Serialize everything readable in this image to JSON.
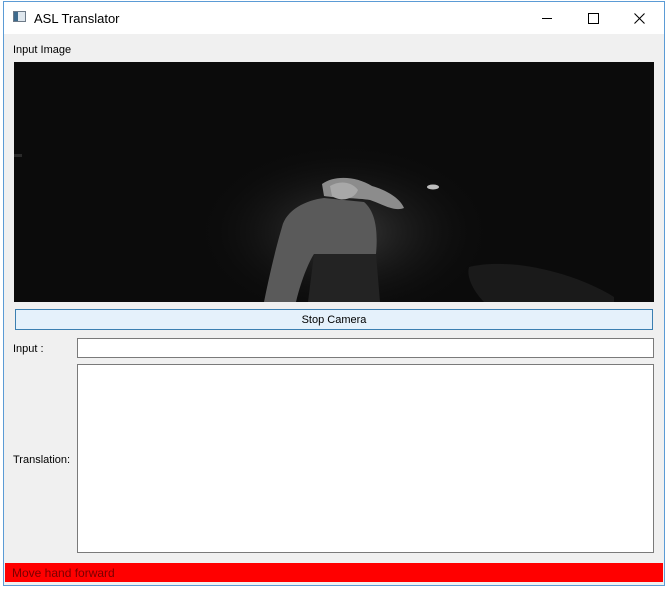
{
  "window": {
    "title": "ASL Translator",
    "icon": "app-window-icon"
  },
  "caption_buttons": {
    "minimize_icon": "minimize-icon",
    "maximize_icon": "maximize-icon",
    "close_icon": "close-icon"
  },
  "input_image": {
    "label": "Input Image"
  },
  "camera_button": {
    "label": "Stop Camera"
  },
  "input_field": {
    "label": "Input :",
    "value": ""
  },
  "translation_field": {
    "label": "Translation:",
    "value": ""
  },
  "status_bar": {
    "text": "Move hand forward",
    "color": "#ff0000"
  }
}
